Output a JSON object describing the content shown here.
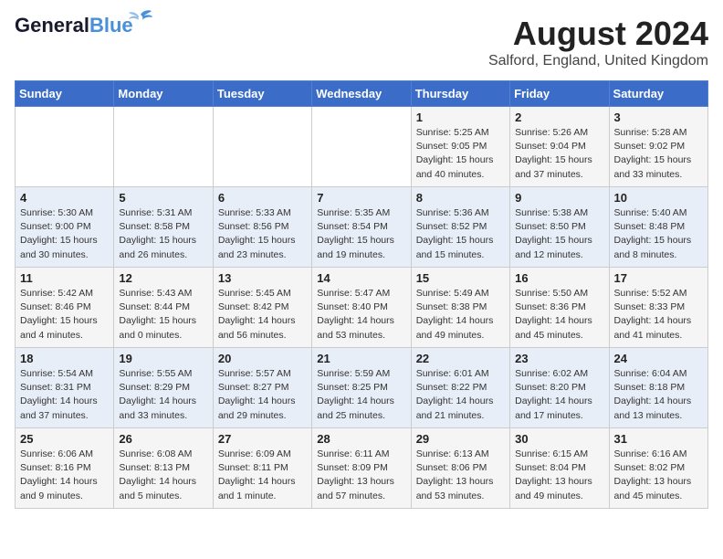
{
  "logo": {
    "line1": "General",
    "line2": "Blue"
  },
  "title": "August 2024",
  "location": "Salford, England, United Kingdom",
  "days_of_week": [
    "Sunday",
    "Monday",
    "Tuesday",
    "Wednesday",
    "Thursday",
    "Friday",
    "Saturday"
  ],
  "weeks": [
    [
      {
        "day": "",
        "sunrise": "",
        "sunset": "",
        "daylight": ""
      },
      {
        "day": "",
        "sunrise": "",
        "sunset": "",
        "daylight": ""
      },
      {
        "day": "",
        "sunrise": "",
        "sunset": "",
        "daylight": ""
      },
      {
        "day": "",
        "sunrise": "",
        "sunset": "",
        "daylight": ""
      },
      {
        "day": "1",
        "sunrise": "Sunrise: 5:25 AM",
        "sunset": "Sunset: 9:05 PM",
        "daylight": "Daylight: 15 hours and 40 minutes."
      },
      {
        "day": "2",
        "sunrise": "Sunrise: 5:26 AM",
        "sunset": "Sunset: 9:04 PM",
        "daylight": "Daylight: 15 hours and 37 minutes."
      },
      {
        "day": "3",
        "sunrise": "Sunrise: 5:28 AM",
        "sunset": "Sunset: 9:02 PM",
        "daylight": "Daylight: 15 hours and 33 minutes."
      }
    ],
    [
      {
        "day": "4",
        "sunrise": "Sunrise: 5:30 AM",
        "sunset": "Sunset: 9:00 PM",
        "daylight": "Daylight: 15 hours and 30 minutes."
      },
      {
        "day": "5",
        "sunrise": "Sunrise: 5:31 AM",
        "sunset": "Sunset: 8:58 PM",
        "daylight": "Daylight: 15 hours and 26 minutes."
      },
      {
        "day": "6",
        "sunrise": "Sunrise: 5:33 AM",
        "sunset": "Sunset: 8:56 PM",
        "daylight": "Daylight: 15 hours and 23 minutes."
      },
      {
        "day": "7",
        "sunrise": "Sunrise: 5:35 AM",
        "sunset": "Sunset: 8:54 PM",
        "daylight": "Daylight: 15 hours and 19 minutes."
      },
      {
        "day": "8",
        "sunrise": "Sunrise: 5:36 AM",
        "sunset": "Sunset: 8:52 PM",
        "daylight": "Daylight: 15 hours and 15 minutes."
      },
      {
        "day": "9",
        "sunrise": "Sunrise: 5:38 AM",
        "sunset": "Sunset: 8:50 PM",
        "daylight": "Daylight: 15 hours and 12 minutes."
      },
      {
        "day": "10",
        "sunrise": "Sunrise: 5:40 AM",
        "sunset": "Sunset: 8:48 PM",
        "daylight": "Daylight: 15 hours and 8 minutes."
      }
    ],
    [
      {
        "day": "11",
        "sunrise": "Sunrise: 5:42 AM",
        "sunset": "Sunset: 8:46 PM",
        "daylight": "Daylight: 15 hours and 4 minutes."
      },
      {
        "day": "12",
        "sunrise": "Sunrise: 5:43 AM",
        "sunset": "Sunset: 8:44 PM",
        "daylight": "Daylight: 15 hours and 0 minutes."
      },
      {
        "day": "13",
        "sunrise": "Sunrise: 5:45 AM",
        "sunset": "Sunset: 8:42 PM",
        "daylight": "Daylight: 14 hours and 56 minutes."
      },
      {
        "day": "14",
        "sunrise": "Sunrise: 5:47 AM",
        "sunset": "Sunset: 8:40 PM",
        "daylight": "Daylight: 14 hours and 53 minutes."
      },
      {
        "day": "15",
        "sunrise": "Sunrise: 5:49 AM",
        "sunset": "Sunset: 8:38 PM",
        "daylight": "Daylight: 14 hours and 49 minutes."
      },
      {
        "day": "16",
        "sunrise": "Sunrise: 5:50 AM",
        "sunset": "Sunset: 8:36 PM",
        "daylight": "Daylight: 14 hours and 45 minutes."
      },
      {
        "day": "17",
        "sunrise": "Sunrise: 5:52 AM",
        "sunset": "Sunset: 8:33 PM",
        "daylight": "Daylight: 14 hours and 41 minutes."
      }
    ],
    [
      {
        "day": "18",
        "sunrise": "Sunrise: 5:54 AM",
        "sunset": "Sunset: 8:31 PM",
        "daylight": "Daylight: 14 hours and 37 minutes."
      },
      {
        "day": "19",
        "sunrise": "Sunrise: 5:55 AM",
        "sunset": "Sunset: 8:29 PM",
        "daylight": "Daylight: 14 hours and 33 minutes."
      },
      {
        "day": "20",
        "sunrise": "Sunrise: 5:57 AM",
        "sunset": "Sunset: 8:27 PM",
        "daylight": "Daylight: 14 hours and 29 minutes."
      },
      {
        "day": "21",
        "sunrise": "Sunrise: 5:59 AM",
        "sunset": "Sunset: 8:25 PM",
        "daylight": "Daylight: 14 hours and 25 minutes."
      },
      {
        "day": "22",
        "sunrise": "Sunrise: 6:01 AM",
        "sunset": "Sunset: 8:22 PM",
        "daylight": "Daylight: 14 hours and 21 minutes."
      },
      {
        "day": "23",
        "sunrise": "Sunrise: 6:02 AM",
        "sunset": "Sunset: 8:20 PM",
        "daylight": "Daylight: 14 hours and 17 minutes."
      },
      {
        "day": "24",
        "sunrise": "Sunrise: 6:04 AM",
        "sunset": "Sunset: 8:18 PM",
        "daylight": "Daylight: 14 hours and 13 minutes."
      }
    ],
    [
      {
        "day": "25",
        "sunrise": "Sunrise: 6:06 AM",
        "sunset": "Sunset: 8:16 PM",
        "daylight": "Daylight: 14 hours and 9 minutes."
      },
      {
        "day": "26",
        "sunrise": "Sunrise: 6:08 AM",
        "sunset": "Sunset: 8:13 PM",
        "daylight": "Daylight: 14 hours and 5 minutes."
      },
      {
        "day": "27",
        "sunrise": "Sunrise: 6:09 AM",
        "sunset": "Sunset: 8:11 PM",
        "daylight": "Daylight: 14 hours and 1 minute."
      },
      {
        "day": "28",
        "sunrise": "Sunrise: 6:11 AM",
        "sunset": "Sunset: 8:09 PM",
        "daylight": "Daylight: 13 hours and 57 minutes."
      },
      {
        "day": "29",
        "sunrise": "Sunrise: 6:13 AM",
        "sunset": "Sunset: 8:06 PM",
        "daylight": "Daylight: 13 hours and 53 minutes."
      },
      {
        "day": "30",
        "sunrise": "Sunrise: 6:15 AM",
        "sunset": "Sunset: 8:04 PM",
        "daylight": "Daylight: 13 hours and 49 minutes."
      },
      {
        "day": "31",
        "sunrise": "Sunrise: 6:16 AM",
        "sunset": "Sunset: 8:02 PM",
        "daylight": "Daylight: 13 hours and 45 minutes."
      }
    ]
  ]
}
